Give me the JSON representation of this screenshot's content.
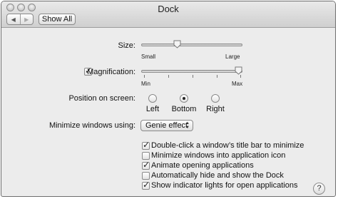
{
  "window": {
    "title": "Dock"
  },
  "toolbar": {
    "back_glyph": "◀",
    "forward_glyph": "▶",
    "show_all_label": "Show All"
  },
  "size": {
    "label": "Size:",
    "min_label": "Small",
    "max_label": "Large",
    "level": 0.34
  },
  "magnification": {
    "label": "Magnification:",
    "checked": true,
    "min_label": "Min",
    "max_label": "Max",
    "level": 1.0
  },
  "position": {
    "label": "Position on screen:",
    "options": [
      "Left",
      "Bottom",
      "Right"
    ],
    "selected": "Bottom"
  },
  "minimize": {
    "label": "Minimize windows using:",
    "value": "Genie effect"
  },
  "options": [
    {
      "label": "Double-click a window’s title bar to minimize",
      "checked": true
    },
    {
      "label": "Minimize windows into application icon",
      "checked": false
    },
    {
      "label": "Animate opening applications",
      "checked": true
    },
    {
      "label": "Automatically hide and show the Dock",
      "checked": false
    },
    {
      "label": "Show indicator lights for open applications",
      "checked": true
    }
  ],
  "help": {
    "glyph": "?"
  }
}
